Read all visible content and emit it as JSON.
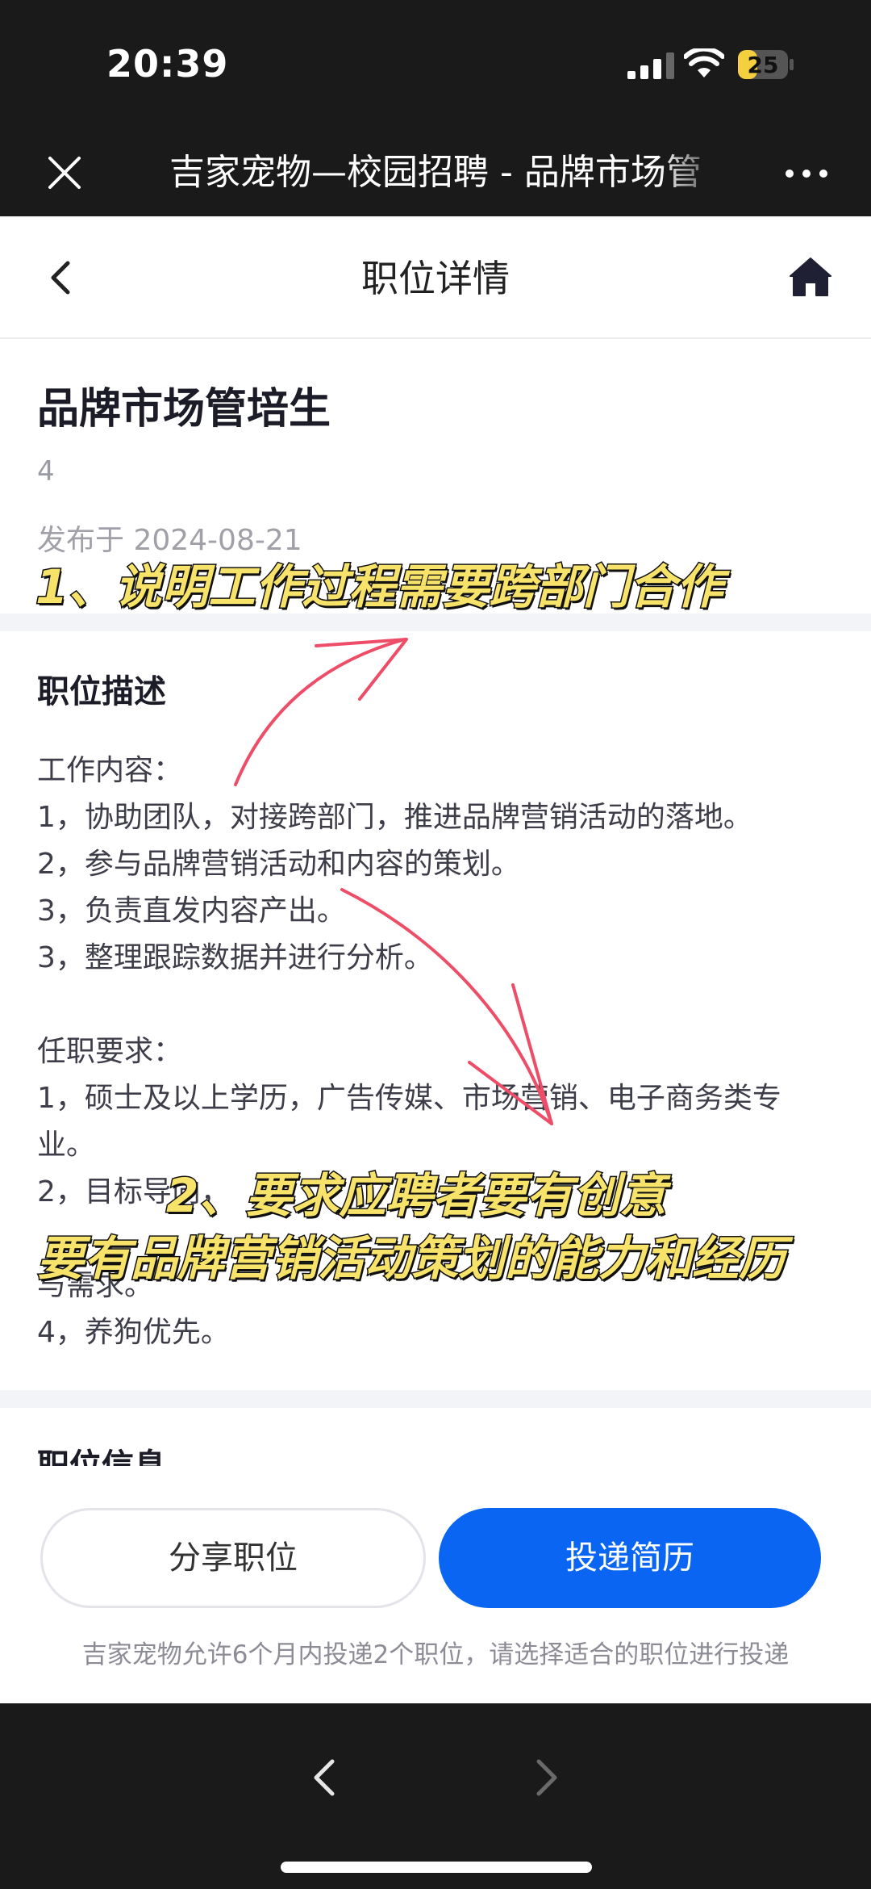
{
  "status_bar": {
    "time": "20:39",
    "battery": "25"
  },
  "browser": {
    "title": "吉家宠物—校园招聘 - 品牌市场管"
  },
  "nav": {
    "title": "职位详情"
  },
  "job": {
    "title": "品牌市场管培生",
    "count": "4",
    "posted": "发布于 2024-08-21"
  },
  "description": {
    "heading": "职位描述",
    "lines": [
      "工作内容：",
      "1，协助团队，对接跨部门，推进品牌营销活动的落地。",
      "2，参与品牌营销活动和内容的策划。",
      "3，负责直发内容产出。",
      "3，整理跟踪数据并进行分析。",
      "",
      "任职要求：",
      "1，硕士及以上学历，广告传媒、市场营销、电子商务类专业。",
      "2，目标导向，",
      "与需求。",
      "4，养狗优先。"
    ]
  },
  "job_info": {
    "heading": "职位信息"
  },
  "actions": {
    "share_label": "分享职位",
    "apply_label": "投递简历",
    "notice": "吉家宠物允许6个月内投递2个职位，请选择适合的职位进行投递",
    "accent_color": "#0a66f2"
  },
  "annotations": {
    "note1": "1、说明工作过程需要跨部门合作",
    "note2_line1": "2、要求应聘者要有创意",
    "note2_line2": "要有品牌营销活动策划的能力和经历",
    "highlight_color": "#f7e36a",
    "arrow_color": "#ee4d68"
  }
}
